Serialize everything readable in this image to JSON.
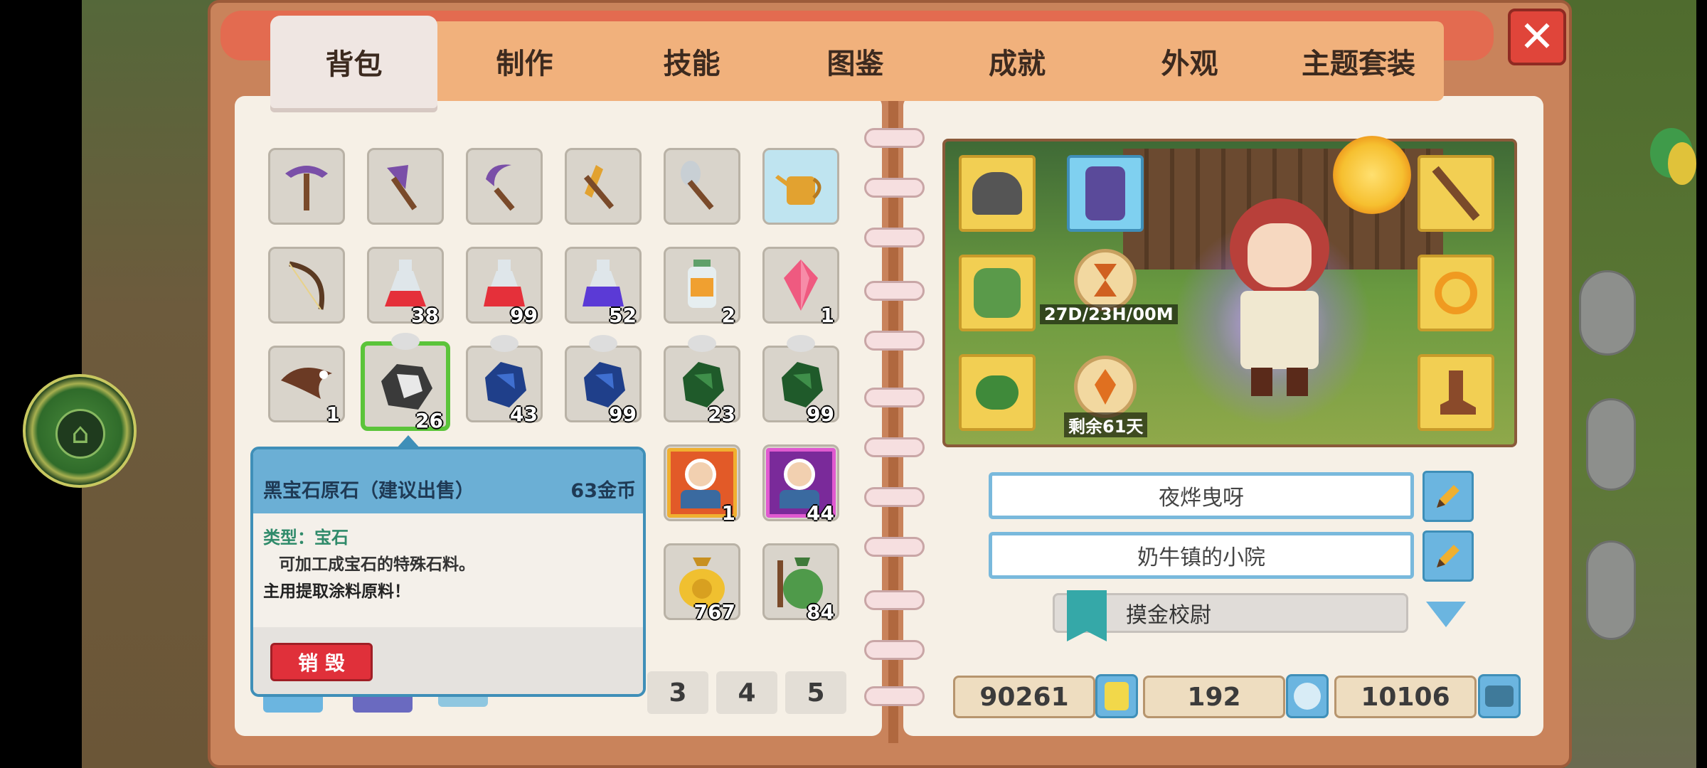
{
  "tabs": [
    "背包",
    "制作",
    "技能",
    "图鉴",
    "成就",
    "外观",
    "主题套装"
  ],
  "inventory": {
    "row2_qty": [
      "38",
      "99",
      "52",
      "2",
      "1"
    ],
    "row3_qty": [
      "1",
      "26",
      "43",
      "99",
      "23",
      "99"
    ],
    "row4_qty": [
      "1",
      "44"
    ],
    "row5_qty": [
      "767",
      "84"
    ]
  },
  "tooltip": {
    "title": "黑宝石原石（建议出售）",
    "price": "63金币",
    "type_label": "类型：宝石",
    "desc_line1": "可加工成宝石的特殊石料。",
    "desc_line2": "主用提取涂料原料！",
    "destroy_label": "销 毁"
  },
  "pager": [
    "3",
    "4",
    "5"
  ],
  "avatar": {
    "timer": "27D/23H/00M",
    "remaining": "剩余61天"
  },
  "profile": {
    "name": "夜烨曳呀",
    "home": "奶牛镇的小院",
    "title": "摸金校尉"
  },
  "currency": {
    "gold": "90261",
    "gems": "192",
    "tickets": "10106"
  },
  "colors": {
    "tab_bar": "#f1b17c",
    "selected_slot": "#5bc43a",
    "tooltip_header": "#6bafd5",
    "destroy_button": "#e0303a"
  }
}
